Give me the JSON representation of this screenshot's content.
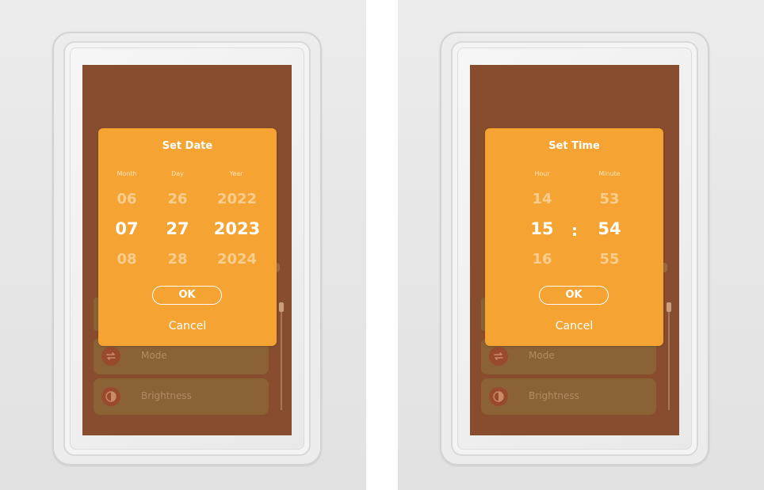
{
  "date_panel": {
    "title": "Set Date",
    "columns": [
      {
        "label": "Month",
        "prev": "06",
        "selected": "07",
        "next": "08"
      },
      {
        "label": "Day",
        "prev": "26",
        "selected": "27",
        "next": "28"
      },
      {
        "label": "Year",
        "prev": "2022",
        "selected": "2023",
        "next": "2024"
      }
    ],
    "ok_label": "OK",
    "cancel_label": "Cancel",
    "menu": [
      {
        "label": "Mode",
        "icon": "repeat-icon"
      },
      {
        "label": "Brightness",
        "icon": "contrast-icon"
      }
    ]
  },
  "time_panel": {
    "title": "Set Time",
    "columns": [
      {
        "label": "Hour",
        "prev": "14",
        "selected": "15",
        "next": "16"
      },
      {
        "label": "Minute",
        "prev": "53",
        "selected": "54",
        "next": "55"
      }
    ],
    "separator": ":",
    "ok_label": "OK",
    "cancel_label": "Cancel",
    "menu": [
      {
        "label": "Mode",
        "icon": "repeat-icon"
      },
      {
        "label": "Brightness",
        "icon": "contrast-icon"
      }
    ]
  },
  "colors": {
    "screen_background": "#874d2e",
    "dialog_background": "#f5a434",
    "dialog_text": "#ffffff"
  }
}
